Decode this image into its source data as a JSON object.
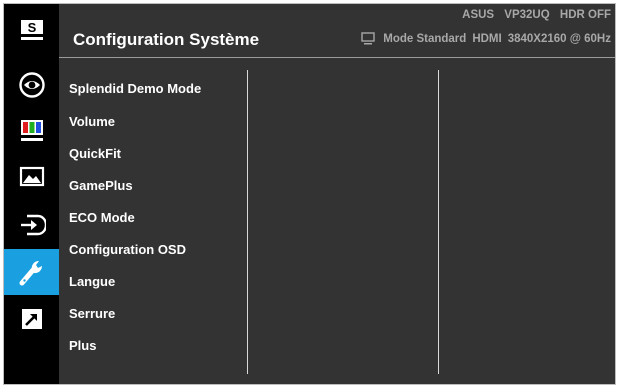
{
  "header": {
    "title": "Configuration Système",
    "brand": "ASUS",
    "model": "VP32UQ",
    "hdr_status": "HDR OFF",
    "mode": "Mode Standard",
    "input": "HDMI",
    "resolution": "3840X2160 @ 60Hz"
  },
  "rail": {
    "items": [
      {
        "icon": "splendid-s-icon"
      },
      {
        "icon": "eye-care-icon"
      },
      {
        "icon": "color-bars-icon"
      },
      {
        "icon": "image-icon"
      },
      {
        "icon": "input-select-icon"
      },
      {
        "icon": "wrench-icon",
        "active": true
      },
      {
        "icon": "shortcut-arrow-icon"
      }
    ],
    "active_color": "#1aa0e0"
  },
  "menu": {
    "items": [
      {
        "label": "Splendid Demo Mode"
      },
      {
        "label": "Volume"
      },
      {
        "label": "QuickFit"
      },
      {
        "label": "GamePlus"
      },
      {
        "label": "ECO Mode"
      },
      {
        "label": "Configuration OSD"
      },
      {
        "label": "Langue"
      },
      {
        "label": "Serrure"
      },
      {
        "label": "Plus"
      }
    ]
  },
  "colors": {
    "background": "#333333",
    "rail": "#000000",
    "text": "#ffffff",
    "status_text": "#a8a8a8"
  }
}
